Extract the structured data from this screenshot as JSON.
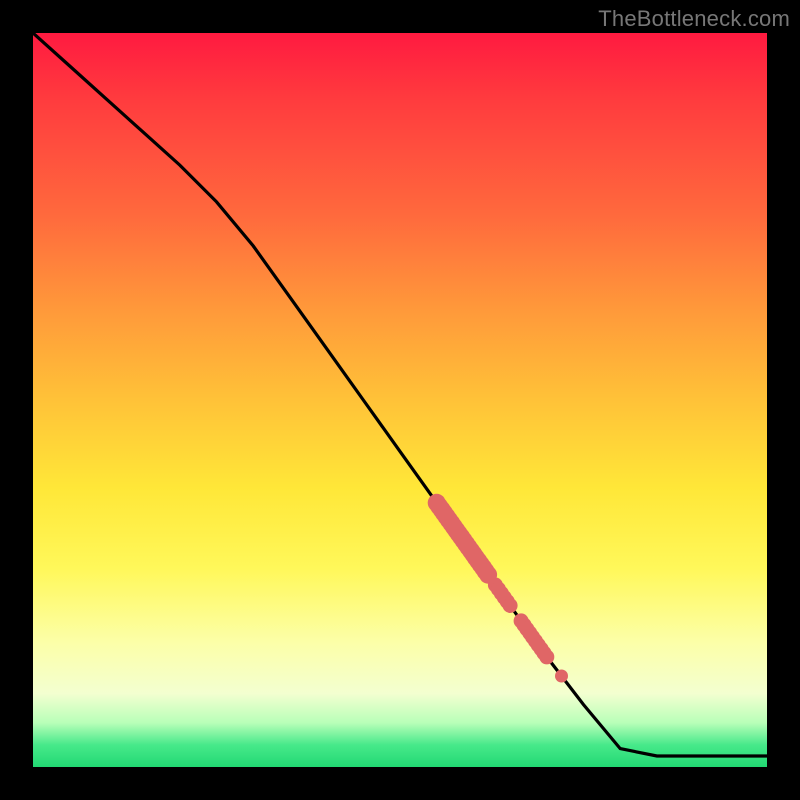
{
  "watermark": "TheBottleneck.com",
  "colors": {
    "line": "#000000",
    "marker_fill": "#e06666",
    "marker_stroke": "#c24f4f"
  },
  "chart_data": {
    "type": "line",
    "title": "",
    "xlabel": "",
    "ylabel": "",
    "xlim": [
      0,
      100
    ],
    "ylim": [
      0,
      100
    ],
    "grid": false,
    "legend": false,
    "background": "rainbow-gradient-vertical",
    "series": [
      {
        "name": "curve",
        "x": [
          0,
          5,
          10,
          15,
          20,
          25,
          30,
          35,
          40,
          45,
          50,
          55,
          60,
          65,
          70,
          75,
          80,
          85,
          90,
          95,
          100
        ],
        "y": [
          100,
          95.5,
          91,
          86.5,
          82,
          77,
          71,
          64,
          57,
          50,
          43,
          36,
          29,
          22,
          15,
          8.5,
          2.5,
          1.5,
          1.5,
          1.5,
          1.5
        ]
      }
    ],
    "markers": [
      {
        "cluster": "top",
        "x_range": [
          55,
          62
        ],
        "y_range": [
          29,
          36
        ],
        "count": 22,
        "thickness": "thick"
      },
      {
        "cluster": "mid",
        "x_range": [
          63,
          65
        ],
        "y_range": [
          22,
          24.5
        ],
        "count": 6,
        "thickness": "medium"
      },
      {
        "cluster": "low",
        "x_range": [
          66.5,
          70
        ],
        "y_range": [
          15,
          19.5
        ],
        "count": 10,
        "thickness": "medium"
      },
      {
        "cluster": "single",
        "x_range": [
          72,
          72
        ],
        "y_range": [
          12.5,
          12.5
        ],
        "count": 1,
        "thickness": "single"
      }
    ],
    "note": "Axes have no visible ticks or labels; values are normalized 0–100 estimates read from plot geometry."
  }
}
